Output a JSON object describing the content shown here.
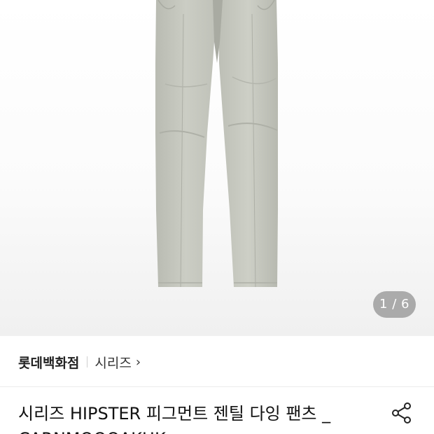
{
  "product_image": {
    "alt": "",
    "counter": "1 / 6"
  },
  "breadcrumb": {
    "store": "롯데백화점",
    "series": "시리즈",
    "chevron": "›"
  },
  "product": {
    "title": "시리즈 HIPSTER 피그먼트 젠틸 다잉 팬츠 _",
    "title_line2": "CARNMOOOAKHK"
  },
  "icons": {
    "share": "share-icon",
    "chevron": "chevron-right-icon"
  },
  "colors": {
    "pants": "#c7c9c0",
    "counter_bg": "#969696"
  }
}
